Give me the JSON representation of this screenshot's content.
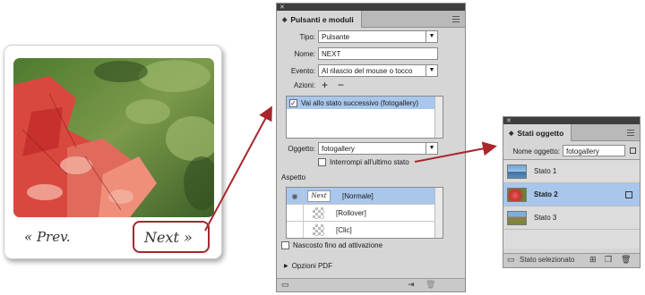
{
  "card": {
    "prev_label": "« Prev.",
    "next_label": "Next »"
  },
  "pulsanti": {
    "title": "Pulsanti e moduli",
    "tipo_label": "Tipo:",
    "tipo_value": "Pulsante",
    "nome_label": "Nome:",
    "nome_value": "NEXT",
    "evento_label": "Evento:",
    "evento_value": "Al rilascio del mouse o tocco",
    "azioni_label": "Azioni:",
    "add_action": "+",
    "remove_action": "−",
    "action_item": "Vai allo stato successivo (fotogallery)",
    "oggetto_label": "Oggetto:",
    "oggetto_value": "fotogallery",
    "interrompi_label": "Interrompi all'ultimo stato",
    "aspetto_label": "Aspetto",
    "states": [
      "[Normale]",
      "[Rollover]",
      "[Clic]"
    ],
    "nascosto_label": "Nascosto fino ad attivazione",
    "opzioni_pdf_label": "Opzioni PDF",
    "thumb_text": "Next"
  },
  "stati": {
    "title": "Stati oggetto",
    "nome_oggetto_label": "Nome oggetto:",
    "nome_oggetto_value": "fotogallery",
    "states": [
      "Stato 1",
      "Stato 2",
      "Stato 3"
    ],
    "footer_label": "Stato selezionato"
  },
  "colors": {
    "selection": "#a9c7ec",
    "arrow": "#a8262c",
    "panel_bg": "#d6d6d6"
  }
}
